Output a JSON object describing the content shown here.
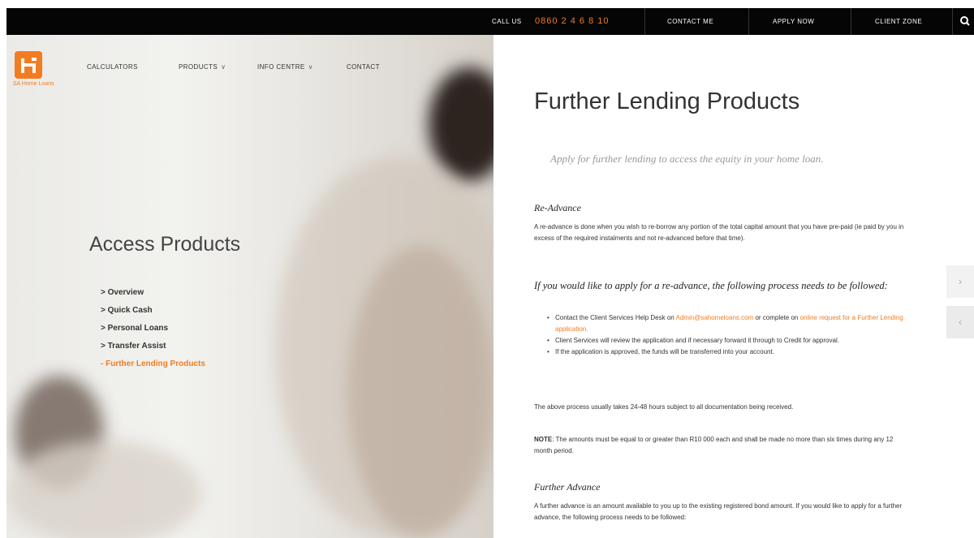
{
  "topbar": {
    "call_label": "CALL US",
    "call_number": "0860 2 4 6 8 10",
    "contact_me": "CONTACT ME",
    "apply_now": "APPLY NOW",
    "client_zone": "CLIENT ZONE"
  },
  "brand": {
    "logo_caption": "SA Home Loans",
    "accent": "#f47c20"
  },
  "nav": {
    "items": [
      {
        "label": "CALCULATORS"
      },
      {
        "label": "PRODUCTS"
      },
      {
        "label": "INFO CENTRE"
      },
      {
        "label": "CONTACT"
      }
    ]
  },
  "sidebar": {
    "title": "Access Products",
    "items": [
      {
        "label": "> Overview"
      },
      {
        "label": "> Quick Cash"
      },
      {
        "label": "> Personal Loans"
      },
      {
        "label": "> Transfer Assist"
      },
      {
        "label": "- Further Lending Products",
        "active": true
      }
    ]
  },
  "main": {
    "title": "Further Lending Products",
    "lead": "Apply for further lending to access the equity in your home loan.",
    "readvance_heading": "Re-Advance",
    "readvance_text": "A re-advance is done when you wish to re-borrow any portion of the total capital amount that you have pre-paid (ie paid by you in excess of the required instalments and not re-advanced before that time).",
    "process_heading": "If you would like to apply for a re-advance, the following process needs to be followed:",
    "bullet1_a": "Contact the Client Services Help Desk on ",
    "bullet1_email": "Admin@sahomeloans.com",
    "bullet1_b": " or complete on ",
    "bullet1_link": "online request for a Further Lending application.",
    "bullet2": "Client Services will review the application and if necessary forward it through to Credit for approval.",
    "bullet3": "If the application is approved, the funds will be transferred into your account.",
    "timing": "The above process usually takes 24-48 hours subject to all documentation being received.",
    "note_label": "NOTE",
    "note_text": ": The amounts must be equal to or greater than R10 000 each and shall be made no more than six times during any 12 month period.",
    "further_heading": "Further Advance",
    "further_text": "A further advance is an amount available to you up to the existing registered bond amount. If you would like to apply for a further advance, the following process needs to be followed:"
  }
}
